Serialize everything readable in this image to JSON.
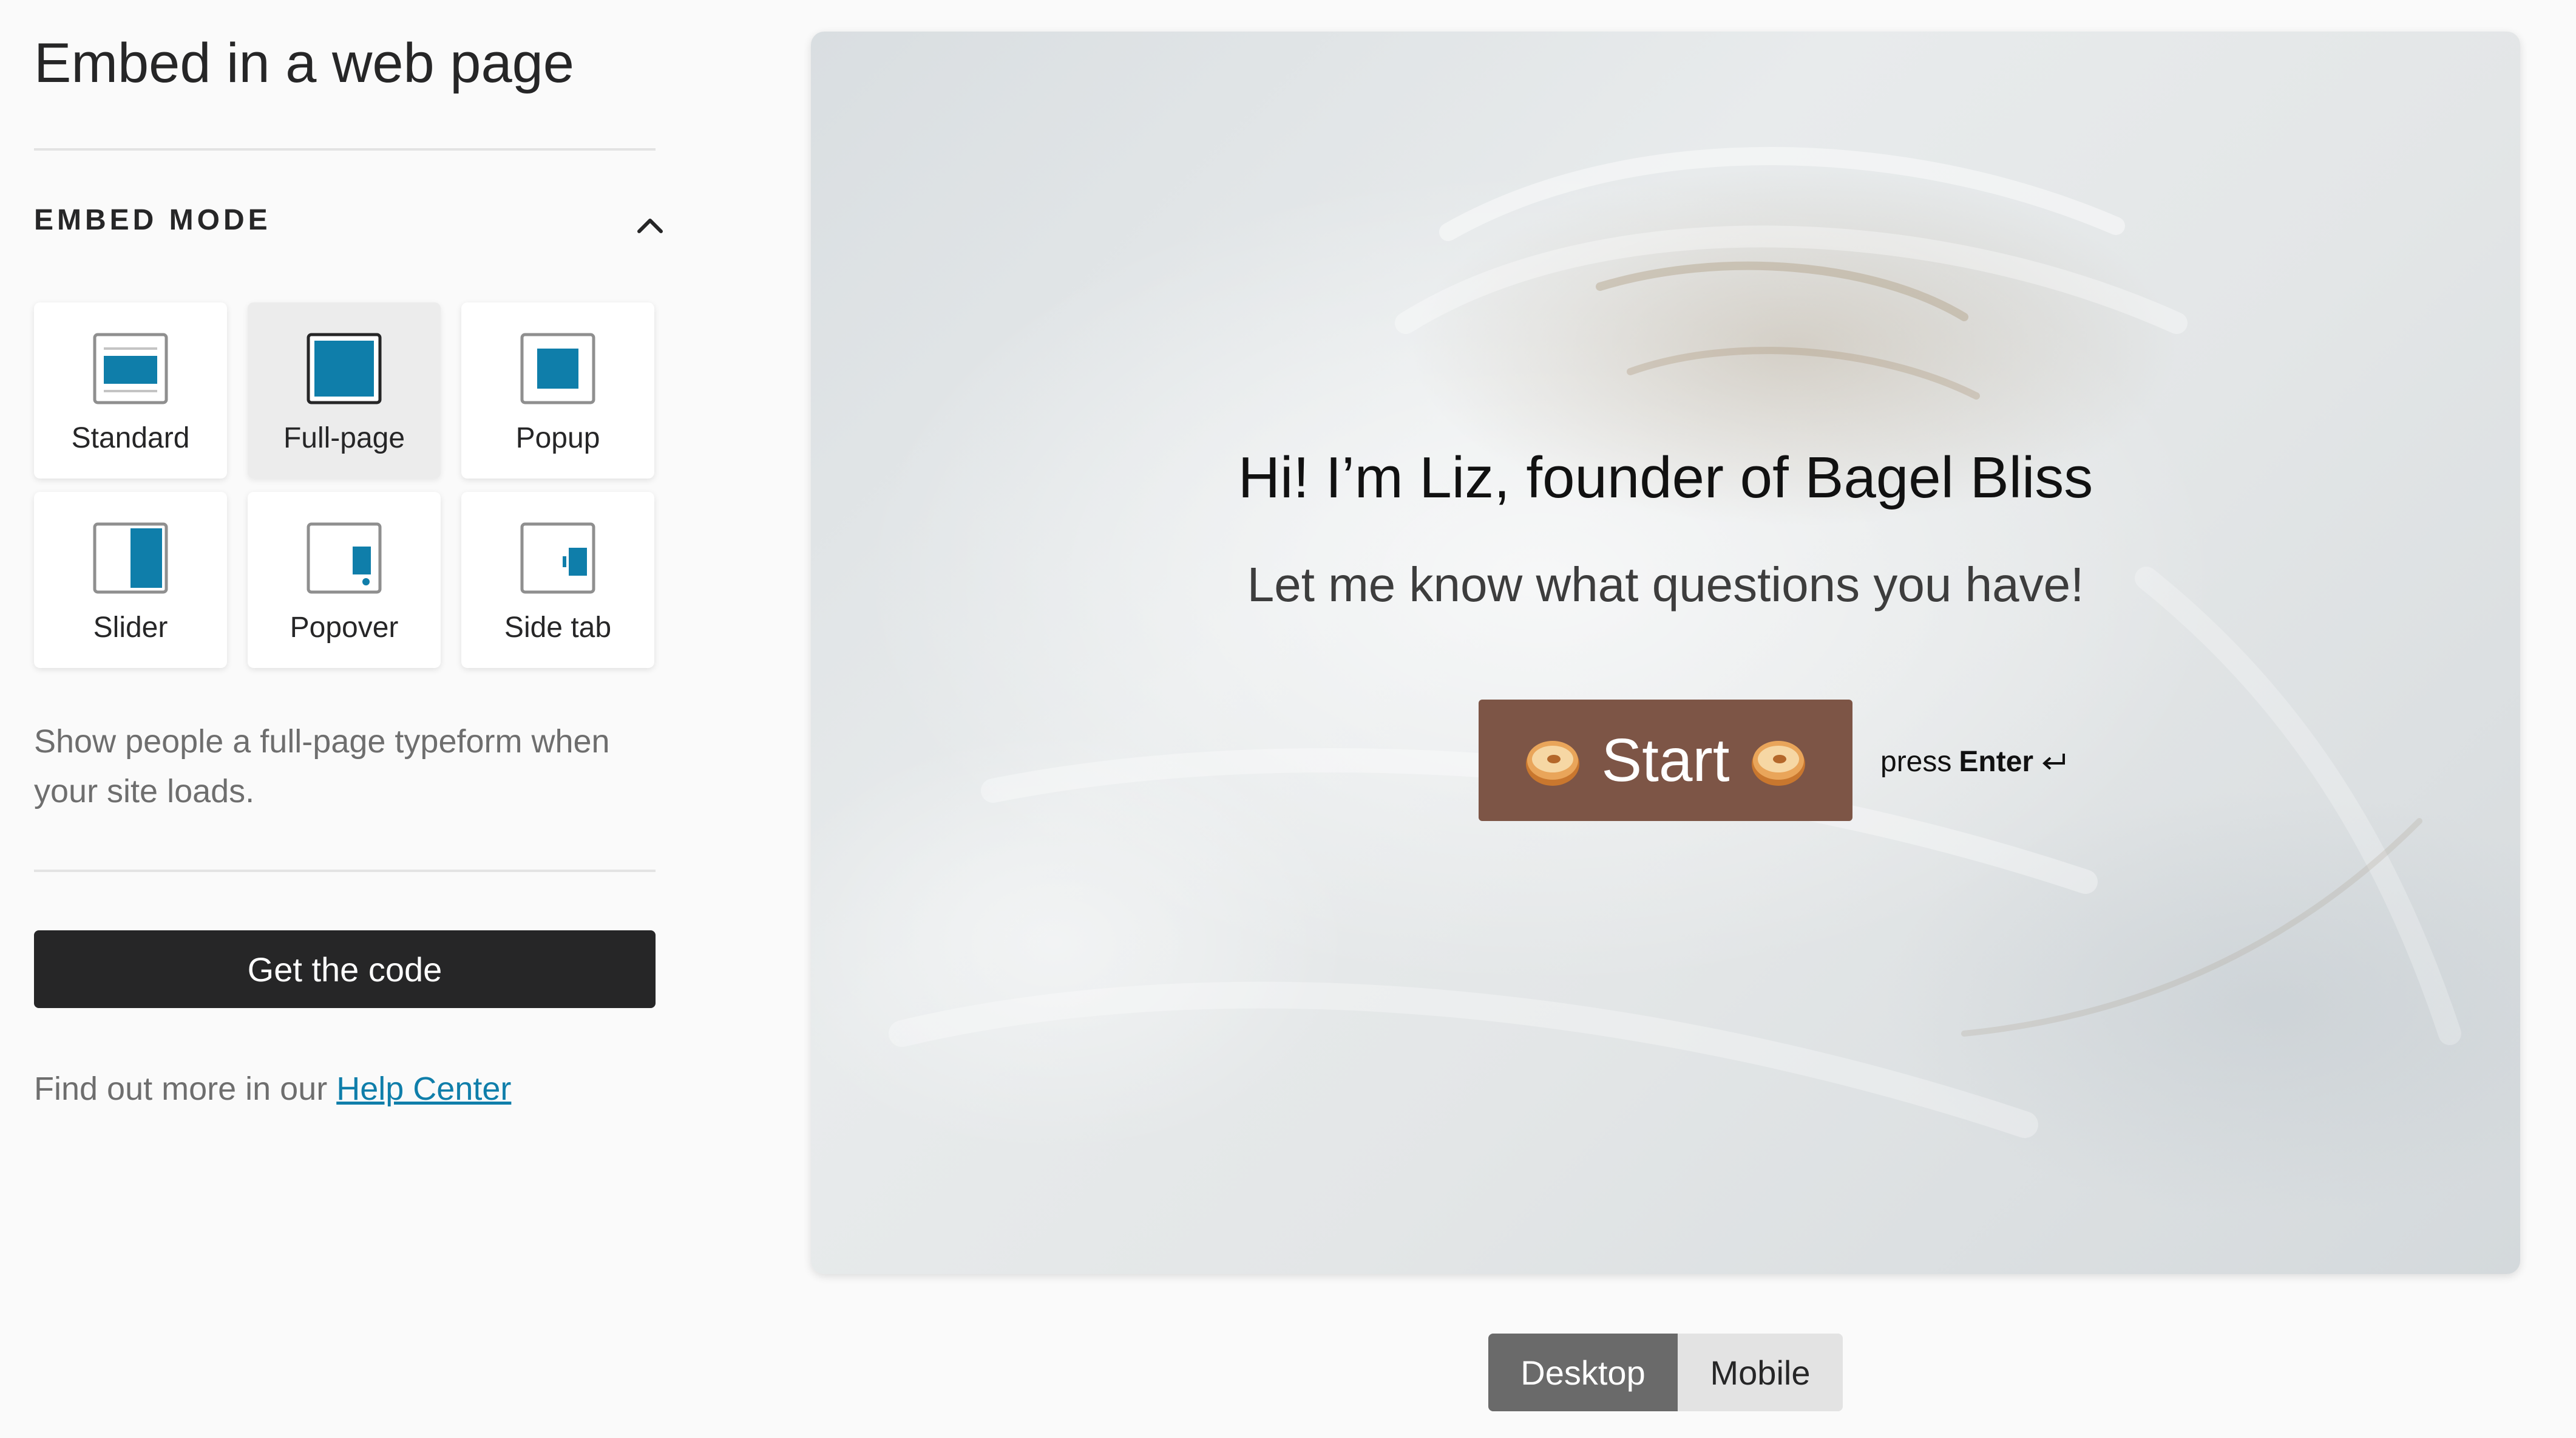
{
  "panel": {
    "title": "Embed in a web page",
    "section_title": "EMBED MODE",
    "section_toggle_icon": "chevron-up-icon",
    "modes": [
      {
        "label": "Standard",
        "icon": "standard-embed-icon",
        "selected": false
      },
      {
        "label": "Full-page",
        "icon": "full-page-embed-icon",
        "selected": true
      },
      {
        "label": "Popup",
        "icon": "popup-embed-icon",
        "selected": false
      },
      {
        "label": "Slider",
        "icon": "slider-embed-icon",
        "selected": false
      },
      {
        "label": "Popover",
        "icon": "popover-embed-icon",
        "selected": false
      },
      {
        "label": "Side tab",
        "icon": "side-tab-embed-icon",
        "selected": false
      }
    ],
    "description": "Show people a full-page typeform when your site loads.",
    "cta_label": "Get the code",
    "help_prefix": "Find out more in our ",
    "help_link": "Help Center"
  },
  "preview": {
    "heading": "Hi! I’m Liz, founder of Bagel Bliss",
    "subheading": "Let me know what questions you have!",
    "start_label": "Start",
    "start_icons": [
      "bagel-icon",
      "bagel-icon"
    ],
    "hint_prefix": "press",
    "hint_key": "Enter",
    "hint_icon": "return-arrow-icon"
  },
  "view_toggle": {
    "options": [
      "Desktop",
      "Mobile"
    ],
    "selected": "Desktop"
  },
  "colors": {
    "accent": "#0f7eaa",
    "cta_background": "#262627",
    "start_button": "#7d5546",
    "link": "#0f7eaa"
  }
}
